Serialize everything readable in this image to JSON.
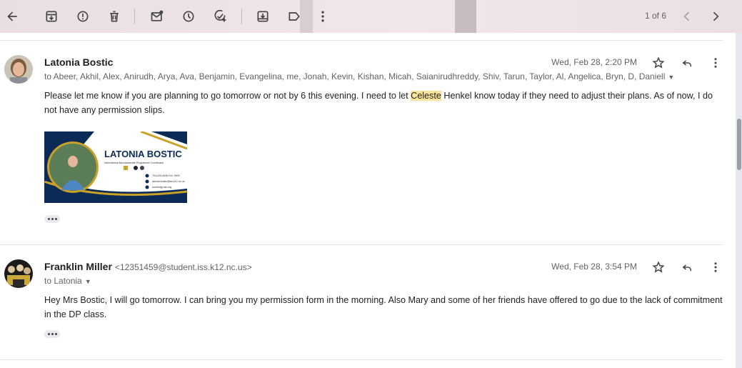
{
  "toolbar": {
    "icons": [
      "back-arrow-icon",
      "archive-icon",
      "report-spam-icon",
      "delete-icon",
      "mark-unread-icon",
      "snooze-icon",
      "add-task-icon",
      "move-to-icon",
      "label-icon",
      "more-vert-icon"
    ],
    "pager_text": "1 of 6"
  },
  "messages": [
    {
      "sender": "Latonia Bostic",
      "to": "to Abeer, Akhil, Alex, Anirudh, Arya, Ava, Benjamin, Evangelina, me, Jonah, Kevin, Kishan, Micah, Saianirudhreddy, Shiv, Tarun, Taylor, Al, Angelica, Bryn, D, Daniell",
      "date": "Wed, Feb 28, 2:20 PM",
      "body_part1": "Please let me know if you are planning to go tomorrow or not by 6 this evening.  I need to let ",
      "body_highlight": "Celeste",
      "body_part2": " Henkel know today if they need to adjust their plans. As of now, I do not have any permission slips.",
      "signature": {
        "name": "LATONIA BOSTIC",
        "role": "International Baccalaureate Programme Coordinator",
        "phone": "704-629-4536 Ext. 9900",
        "email": "latonia.bostic@iss.k12.nc.us",
        "web": "southhigh.iss.org",
        "colors": {
          "navy": "#0b2a55",
          "gold": "#c9a227"
        }
      }
    },
    {
      "sender": "Franklin Miller",
      "email": "<12351459@student.iss.k12.nc.us>",
      "to": "to Latonia",
      "date": "Wed, Feb 28, 3:54 PM",
      "body": "Hey Mrs Bostic, I will go tomorrow. I can bring you my permission form in the morning. Also Mary and some of her friends have offered to go due to the lack of commitment in the DP class."
    }
  ]
}
